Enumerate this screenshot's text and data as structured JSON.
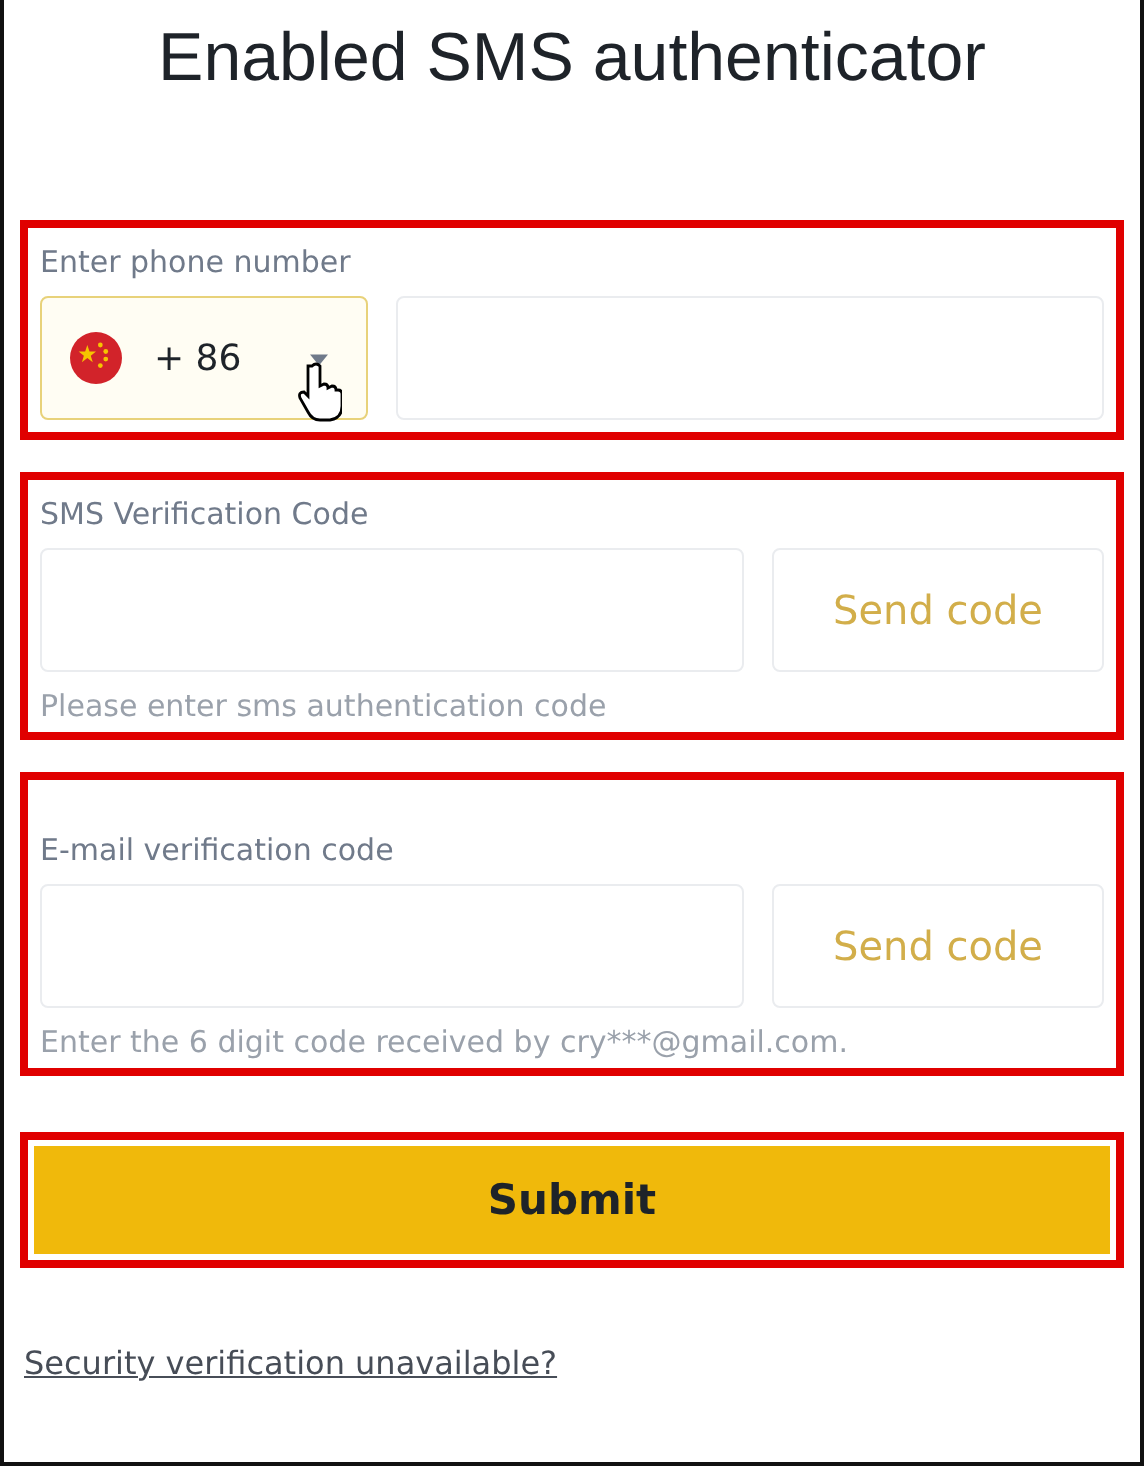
{
  "title": "Enabled SMS authenticator",
  "sections": [
    {
      "kind": "phone",
      "highlighted": true,
      "label": "Enter phone number",
      "country_code": "+ 86",
      "focused": true
    },
    {
      "kind": "code",
      "highlighted": true,
      "label": "SMS Verification Code",
      "button": "Send code",
      "hint": "Please enter sms authentication code"
    },
    {
      "kind": "code",
      "highlighted": true,
      "label": "E-mail verification code",
      "button": "Send code",
      "hint": "Enter the 6 digit code received by cry***@gmail.com."
    }
  ],
  "submit": {
    "label": "Submit",
    "highlighted": true
  },
  "link": "Security verification unavailable?"
}
